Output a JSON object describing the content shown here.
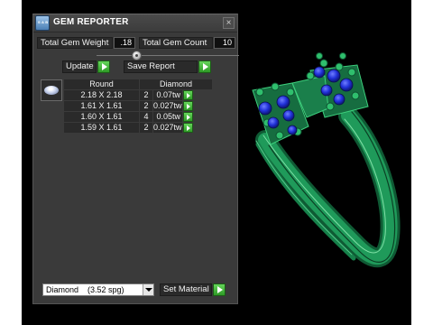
{
  "panel": {
    "title": "GEM REPORTER",
    "app_icon_text": "SAB\nMEE",
    "close_glyph": "×"
  },
  "stats": {
    "total_weight_label": "Total Gem Weight",
    "total_weight_value": ".18",
    "total_count_label": "Total Gem Count",
    "total_count_value": "10"
  },
  "actions": {
    "update_label": "Update",
    "save_report_label": "Save Report"
  },
  "table": {
    "header_shape": "Round",
    "header_material": "Diamond",
    "rows": [
      {
        "size": "2.18 X 2.18",
        "count": "2",
        "weight": "0.07tw"
      },
      {
        "size": "1.61 X 1.61",
        "count": "2",
        "weight": "0.027tw"
      },
      {
        "size": "1.60 X 1.61",
        "count": "4",
        "weight": "0.05tw"
      },
      {
        "size": "1.59 X 1.61",
        "count": "2",
        "weight": "0.027tw"
      }
    ]
  },
  "material": {
    "selected": "Diamond    (3.52 spg)",
    "set_material_label": "Set Material"
  },
  "colors": {
    "ring_green": "#1f9a5a",
    "gem_blue": "#2030d8",
    "accent_green": "#3fbf35"
  }
}
